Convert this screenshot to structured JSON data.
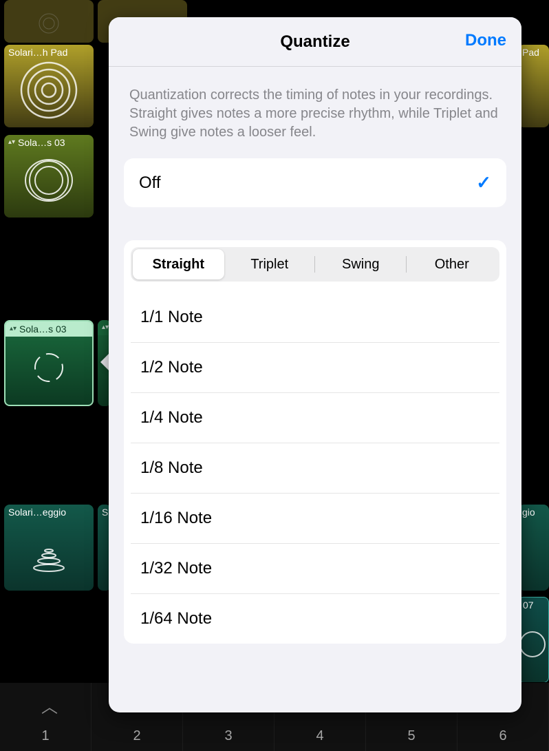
{
  "popover": {
    "title": "Quantize",
    "done": "Done",
    "description": "Quantization corrects the timing of notes in your recordings. Straight gives notes a more precise rhythm, while Triplet and Swing give notes a looser feel.",
    "off_label": "Off",
    "off_selected": true,
    "segments": [
      "Straight",
      "Triplet",
      "Swing",
      "Other"
    ],
    "segment_selected": 0,
    "notes": [
      "1/1 Note",
      "1/2 Note",
      "1/4 Note",
      "1/8 Note",
      "1/16 Note",
      "1/32 Note",
      "1/64 Note"
    ]
  },
  "cells": {
    "yellow1": "Solari…h Pad",
    "green1": "Sola…s 03",
    "mint": "Sola…s 03",
    "teal1": "Solari…eggio",
    "teal2_suffix": "gio",
    "teal3_suffix": "07",
    "pad_right": "Pad"
  },
  "ruler": [
    "1",
    "2",
    "3",
    "4",
    "5",
    "6"
  ]
}
